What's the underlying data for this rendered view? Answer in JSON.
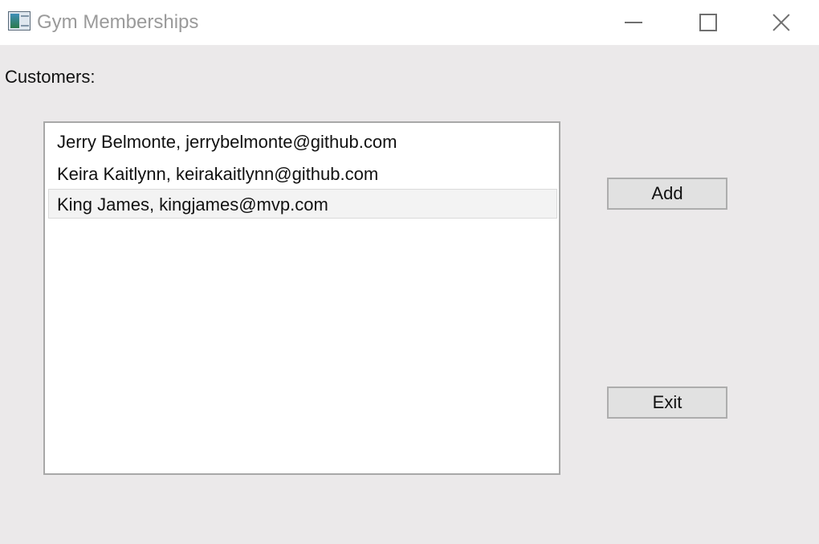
{
  "window": {
    "title": "Gym Memberships"
  },
  "main": {
    "customers_label": "Customers:",
    "customers": [
      {
        "text": "Jerry Belmonte, jerrybelmonte@github.com",
        "selected": false
      },
      {
        "text": "Keira Kaitlynn, keirakaitlynn@github.com",
        "selected": false
      },
      {
        "text": "King James, kingjames@mvp.com",
        "selected": true
      }
    ],
    "add_label": "Add",
    "exit_label": "Exit"
  },
  "icons": {
    "app": "app-window-icon",
    "minimize": "minimize-icon",
    "maximize": "maximize-icon",
    "close": "close-icon"
  },
  "colors": {
    "background": "#ebe9ea",
    "selection_background": "#f3f3f3",
    "button_background": "#e1e1e1"
  }
}
